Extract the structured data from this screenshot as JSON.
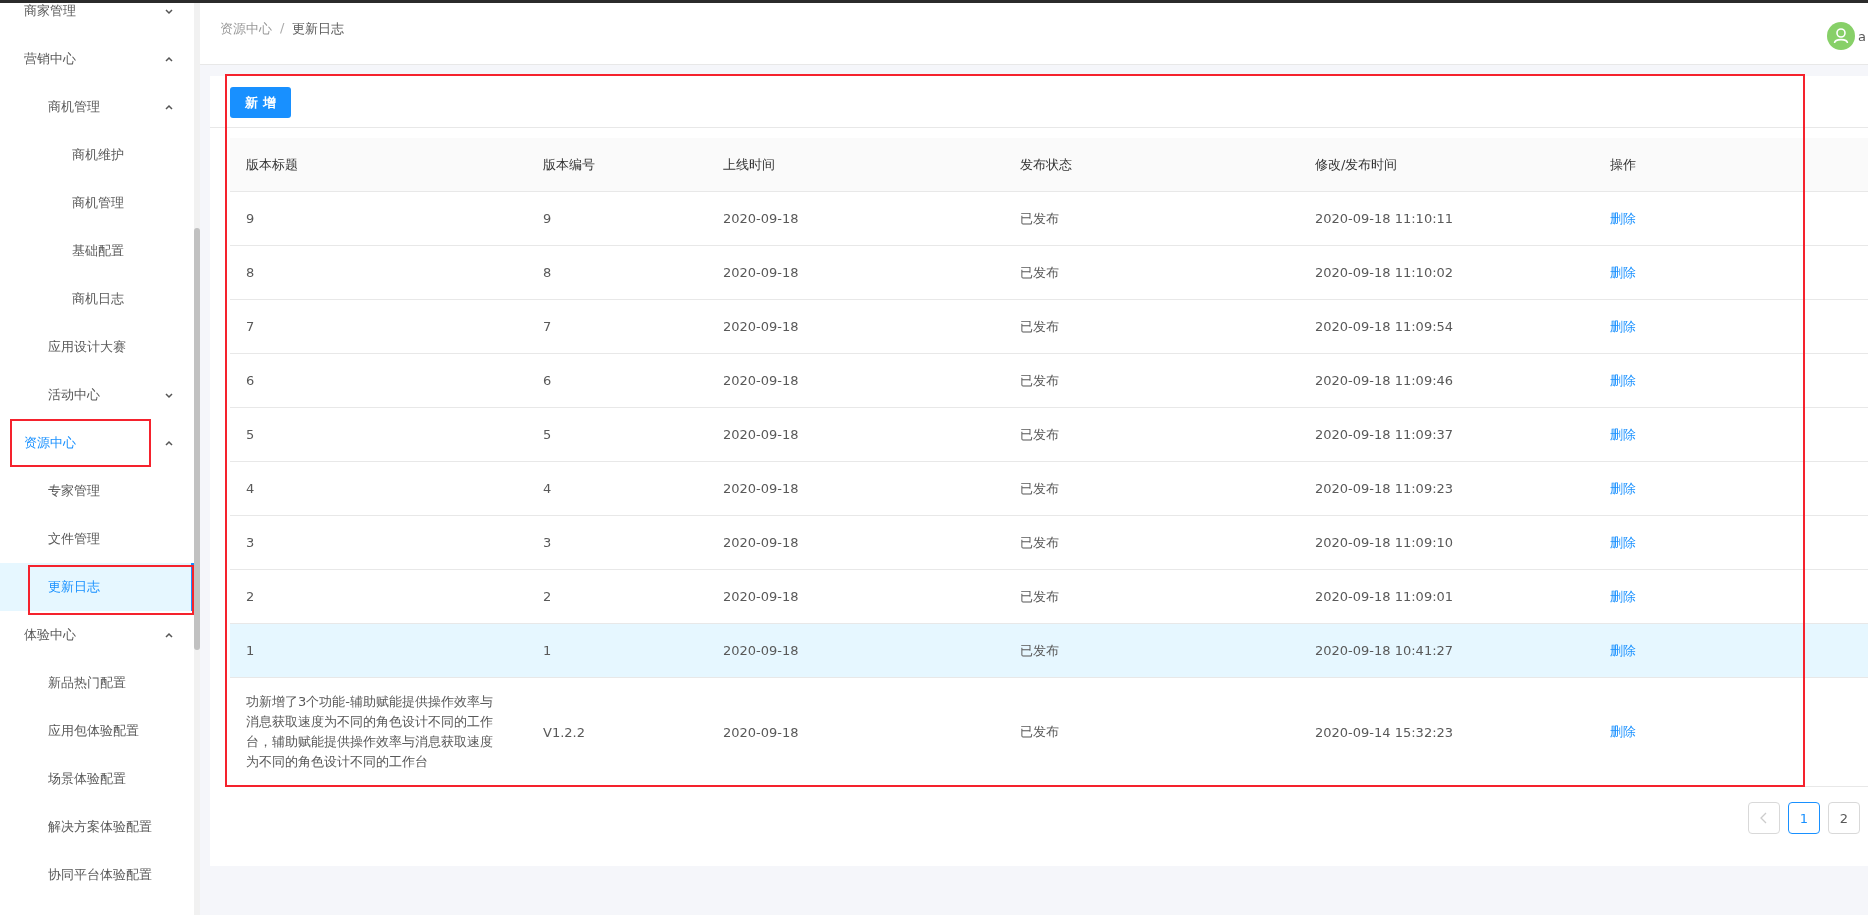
{
  "sidebar": {
    "items": [
      {
        "label": "商家管理",
        "expanded": false,
        "selected": false,
        "highlighted": false
      },
      {
        "label": "营销中心",
        "expanded": true,
        "selected": false,
        "highlighted": false,
        "children": [
          {
            "label": "商机管理",
            "expanded": true,
            "selected": false,
            "highlighted": false,
            "children": [
              {
                "label": "商机维护",
                "selected": false,
                "highlighted": false
              },
              {
                "label": "商机管理",
                "selected": false,
                "highlighted": false
              },
              {
                "label": "基础配置",
                "selected": false,
                "highlighted": false
              },
              {
                "label": "商机日志",
                "selected": false,
                "highlighted": false
              }
            ]
          },
          {
            "label": "应用设计大赛",
            "selected": false,
            "highlighted": false
          },
          {
            "label": "活动中心",
            "expanded": false,
            "selected": false,
            "highlighted": false
          }
        ]
      },
      {
        "label": "资源中心",
        "expanded": true,
        "selected": true,
        "highlighted": true,
        "children": [
          {
            "label": "专家管理",
            "selected": false,
            "highlighted": false
          },
          {
            "label": "文件管理",
            "selected": false,
            "highlighted": false
          },
          {
            "label": "更新日志",
            "selected": true,
            "highlighted": true
          }
        ]
      },
      {
        "label": "体验中心",
        "expanded": true,
        "selected": false,
        "highlighted": false,
        "children": [
          {
            "label": "新品热门配置",
            "selected": false,
            "highlighted": false
          },
          {
            "label": "应用包体验配置",
            "selected": false,
            "highlighted": false
          },
          {
            "label": "场景体验配置",
            "selected": false,
            "highlighted": false
          },
          {
            "label": "解决方案体验配置",
            "selected": false,
            "highlighted": false
          },
          {
            "label": "协同平台体验配置",
            "selected": false,
            "highlighted": false
          }
        ]
      }
    ]
  },
  "header": {
    "breadcrumb": [
      "资源中心",
      "更新日志"
    ],
    "separator": "/",
    "user_name": "a"
  },
  "toolbar": {
    "add_button": "新 增",
    "highlighted": true
  },
  "table": {
    "columns": [
      "版本标题",
      "版本编号",
      "上线时间",
      "发布状态",
      "修改/发布时间",
      "操作"
    ],
    "rows": [
      {
        "title": "9",
        "version": "9",
        "date": "2020-09-18",
        "status": "已发布",
        "modified": "2020-09-18 11:10:11",
        "action": "删除",
        "hovered": false
      },
      {
        "title": "8",
        "version": "8",
        "date": "2020-09-18",
        "status": "已发布",
        "modified": "2020-09-18 11:10:02",
        "action": "删除",
        "hovered": false
      },
      {
        "title": "7",
        "version": "7",
        "date": "2020-09-18",
        "status": "已发布",
        "modified": "2020-09-18 11:09:54",
        "action": "删除",
        "hovered": false
      },
      {
        "title": "6",
        "version": "6",
        "date": "2020-09-18",
        "status": "已发布",
        "modified": "2020-09-18 11:09:46",
        "action": "删除",
        "hovered": false
      },
      {
        "title": "5",
        "version": "5",
        "date": "2020-09-18",
        "status": "已发布",
        "modified": "2020-09-18 11:09:37",
        "action": "删除",
        "hovered": false
      },
      {
        "title": "4",
        "version": "4",
        "date": "2020-09-18",
        "status": "已发布",
        "modified": "2020-09-18 11:09:23",
        "action": "删除",
        "hovered": false
      },
      {
        "title": "3",
        "version": "3",
        "date": "2020-09-18",
        "status": "已发布",
        "modified": "2020-09-18 11:09:10",
        "action": "删除",
        "hovered": false
      },
      {
        "title": "2",
        "version": "2",
        "date": "2020-09-18",
        "status": "已发布",
        "modified": "2020-09-18 11:09:01",
        "action": "删除",
        "hovered": false
      },
      {
        "title": "1",
        "version": "1",
        "date": "2020-09-18",
        "status": "已发布",
        "modified": "2020-09-18 10:41:27",
        "action": "删除",
        "hovered": true
      },
      {
        "title": "功新增了3个功能-辅助赋能提供操作效率与消息获取速度为不同的角色设计不同的工作台，辅助赋能提供操作效率与消息获取速度为不同的角色设计不同的工作台",
        "version": "V1.2.2",
        "date": "2020-09-18",
        "status": "已发布",
        "modified": "2020-09-14 15:32:23",
        "action": "删除",
        "hovered": false
      }
    ]
  },
  "pagination": {
    "pages": [
      {
        "label": "1",
        "selected": true
      },
      {
        "label": "2",
        "selected": false
      }
    ]
  }
}
